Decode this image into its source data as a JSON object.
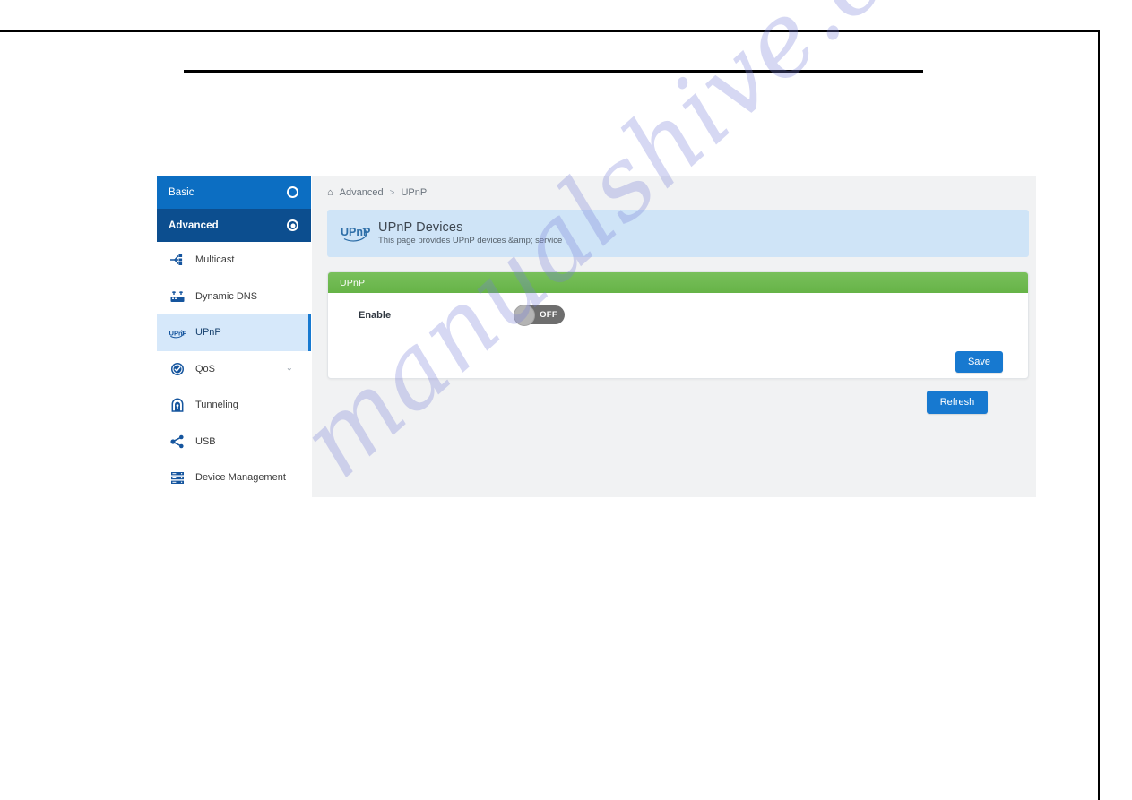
{
  "page": {
    "watermark": "manualshive.com"
  },
  "sidebar": {
    "modes": [
      {
        "label": "Basic",
        "icon": "radio-unselected-icon",
        "selected": false
      },
      {
        "label": "Advanced",
        "icon": "radio-selected-icon",
        "selected": true
      }
    ],
    "items": [
      {
        "label": "Multicast",
        "icon": "multicast-icon"
      },
      {
        "label": "Dynamic DNS",
        "icon": "dynamic-dns-icon"
      },
      {
        "label": "UPnP",
        "icon": "upnp-icon"
      },
      {
        "label": "QoS",
        "icon": "qos-icon",
        "caret": "⌄"
      },
      {
        "label": "Tunneling",
        "icon": "tunneling-icon"
      },
      {
        "label": "USB",
        "icon": "usb-share-icon"
      },
      {
        "label": "Device Management",
        "icon": "device-management-icon"
      }
    ]
  },
  "breadcrumb": {
    "home_icon": "⌂",
    "parent": "Advanced",
    "separator": ">",
    "current": "UPnP"
  },
  "header": {
    "logo_text": "UPnP",
    "title": "UPnP Devices",
    "subtitle": "This page provides UPnP devices &amp; service"
  },
  "card": {
    "title": "UPnP",
    "rows": [
      {
        "label": "Enable",
        "control": "toggle",
        "state": "OFF"
      }
    ],
    "save_label": "Save"
  },
  "actions": {
    "refresh_label": "Refresh"
  },
  "colors": {
    "nav_basic": "#0c6ec2",
    "nav_advanced": "#0c4e8f",
    "nav_selected_bg": "#d6e8fa",
    "accent_blue": "#1779d0",
    "card_header_green": "#6cb94f",
    "panel_head_blue": "#cfe4f7",
    "toggle_off_track": "#6e6e6e",
    "content_bg": "#f1f2f3"
  }
}
